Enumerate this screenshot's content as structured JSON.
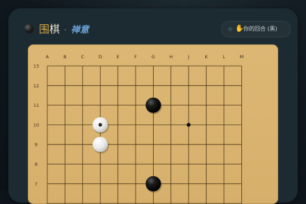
{
  "header": {
    "title_accent": "围",
    "title_main": "棋",
    "separator": "·",
    "subtitle": "禅意",
    "turn": {
      "hand_icon": "hand-icon",
      "label": "你的回合 (黑)"
    }
  },
  "board": {
    "columns": [
      "A",
      "B",
      "C",
      "D",
      "E",
      "F",
      "G",
      "H",
      "J",
      "K",
      "L",
      "M"
    ],
    "rows_visible": [
      "13",
      "12",
      "11",
      "10",
      "9",
      "8",
      "7"
    ],
    "stones": [
      {
        "color": "black",
        "col": "G",
        "row": "11"
      },
      {
        "color": "white",
        "col": "D",
        "row": "10",
        "last_move": true
      },
      {
        "color": "white",
        "col": "D",
        "row": "9"
      },
      {
        "color": "black",
        "col": "G",
        "row": "7"
      }
    ],
    "star_points": [
      {
        "col": "J",
        "row": "10"
      }
    ],
    "colors": {
      "board": "#d8b36e",
      "line": "#4a3417",
      "background": "#1c2a31",
      "accent": "#d4a743"
    }
  }
}
